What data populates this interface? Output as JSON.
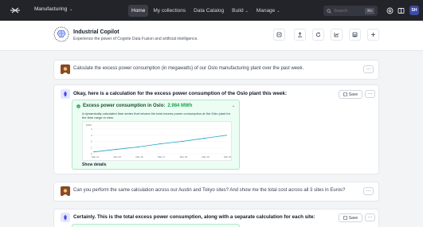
{
  "topbar": {
    "app_switch_label": "Manufacturing",
    "nav": [
      {
        "label": "Home",
        "active": true,
        "has_chevron": false
      },
      {
        "label": "My collections",
        "active": false,
        "has_chevron": false
      },
      {
        "label": "Data Catalog",
        "active": false,
        "has_chevron": false
      },
      {
        "label": "Build",
        "active": false,
        "has_chevron": true
      },
      {
        "label": "Manage",
        "active": false,
        "has_chevron": true
      }
    ],
    "search_placeholder": "Search",
    "search_shortcut": "⌘K",
    "avatar_initials": "SH"
  },
  "header": {
    "title": "Industrial Copilot",
    "subtitle": "Experience the power of Cognite Data Fusion and artificial intelligence."
  },
  "conversation": {
    "q1": "Calculate the excess power consumption (in megawatts) of our Oslo manufacturing plant over the past week.",
    "a1": "Okay, here is a calculation for the excess power consumption of the Oslo plant this week:",
    "save_label": "Save",
    "result": {
      "title_prefix": "Excess power consumption in Oslo:",
      "title_value": "2.984 MWh",
      "description": "A dynamically calculated time series that returns the total excess power consumption at the Oslo plant for the time range in view.",
      "show_details": "Show details"
    },
    "q2": "Can you perform the same calculation across our Austin and Tokyo sites? And show me the total cost across all 3 sites in Euros?",
    "a2": "Certainly. This is the total excess power consumption, along with a separate calculation for each site:"
  },
  "chart_data": {
    "type": "line",
    "ylabel": "MWh",
    "y_ticks": [
      "4",
      "3",
      "2",
      "1",
      "0"
    ],
    "ylim": [
      0,
      4
    ],
    "categories": [
      "Mar 14",
      "Mar 15",
      "Mar 16",
      "Mar 17",
      "Mar 18",
      "Mar 19",
      "Mar 20"
    ],
    "series": [
      {
        "color": "#22a0c5",
        "values": [
          0.3,
          0.7,
          1.1,
          1.6,
          2.0,
          2.5,
          2.98
        ]
      }
    ]
  }
}
